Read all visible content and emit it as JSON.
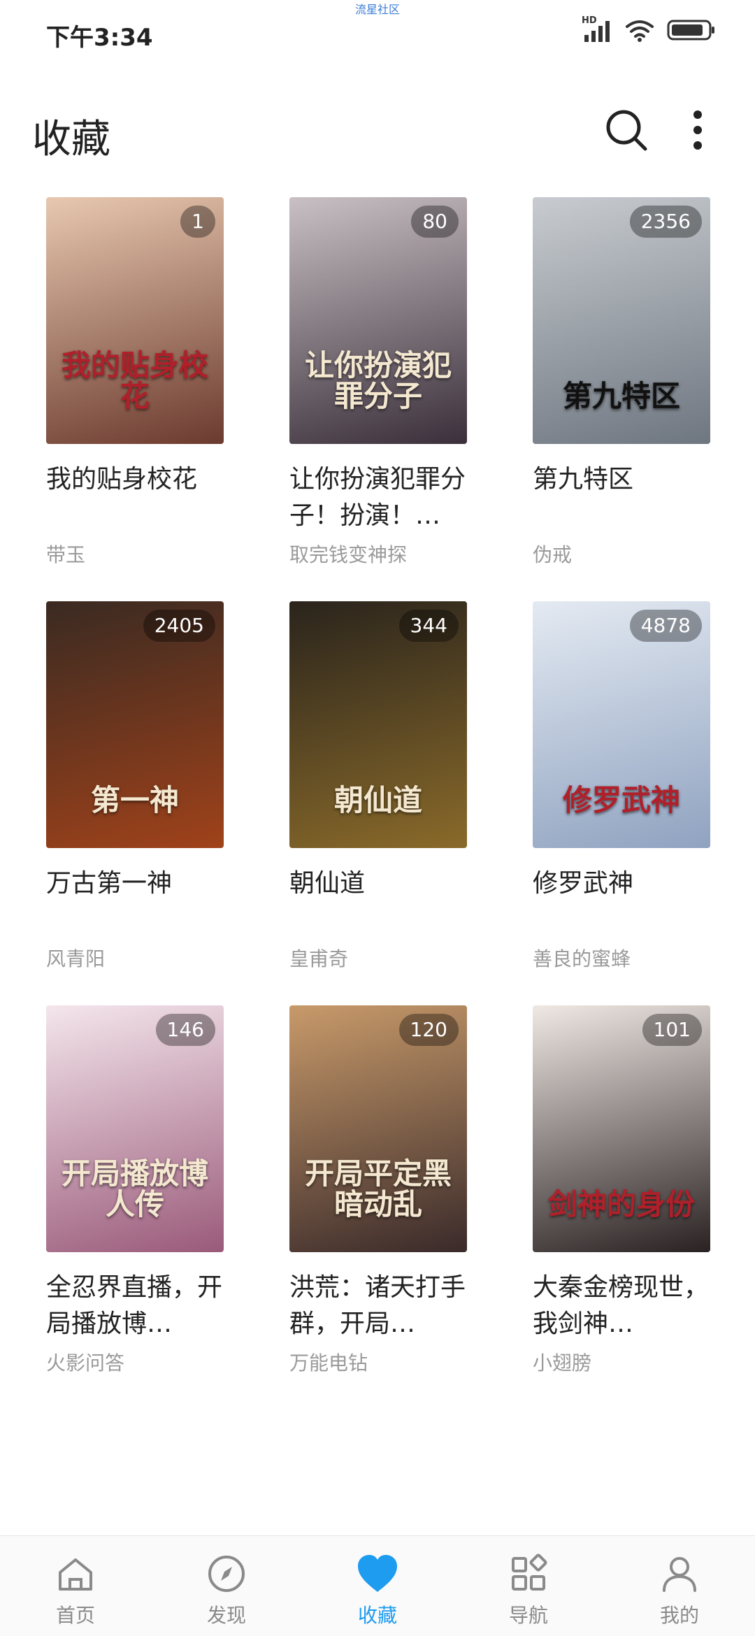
{
  "status_bar": {
    "time": "下午3:34",
    "center_text": "流星社区",
    "network_label": "HD"
  },
  "header": {
    "title": "收藏",
    "search_icon": "search-icon",
    "more_icon": "more-vertical-icon"
  },
  "books": [
    {
      "title": "我的贴身校花",
      "author": "带玉",
      "badge": "1",
      "cover_text": "我的贴身校花",
      "cover_colors": [
        "#e8c8b0",
        "#6b3a2e"
      ]
    },
    {
      "title": "让你扮演犯罪分子！扮演！…",
      "author": "取完钱变神探",
      "badge": "80",
      "cover_text": "让你扮演犯罪分子",
      "cover_colors": [
        "#c9c0c4",
        "#3a2f3a"
      ]
    },
    {
      "title": "第九特区",
      "author": "伪戒",
      "badge": "2356",
      "cover_text": "第九特区",
      "cover_colors": [
        "#c8ccd0",
        "#6e7680"
      ]
    },
    {
      "title": "万古第一神",
      "author": "风青阳",
      "badge": "2405",
      "cover_text": "第一神",
      "cover_colors": [
        "#3a2a22",
        "#a0421a"
      ]
    },
    {
      "title": "朝仙道",
      "author": "皇甫奇",
      "badge": "344",
      "cover_text": "朝仙道",
      "cover_colors": [
        "#2a241c",
        "#8a6a2a"
      ]
    },
    {
      "title": "修罗武神",
      "author": "善良的蜜蜂",
      "badge": "4878",
      "cover_text": "修罗武神",
      "cover_colors": [
        "#e4eaf2",
        "#8fa2c0"
      ]
    },
    {
      "title": "全忍界直播，开局播放博…",
      "author": "火影问答",
      "badge": "146",
      "cover_text": "开局播放博人传",
      "cover_colors": [
        "#f4e6ec",
        "#9a5a7a"
      ]
    },
    {
      "title": "洪荒：诸天打手群，开局…",
      "author": "万能电钻",
      "badge": "120",
      "cover_text": "开局平定黑暗动乱",
      "cover_colors": [
        "#c89a6a",
        "#3a2a2a"
      ]
    },
    {
      "title": "大秦金榜现世，我剑神…",
      "author": "小翅膀",
      "badge": "101",
      "cover_text": "剑神的身份",
      "cover_colors": [
        "#f0e8e4",
        "#2a2222"
      ]
    }
  ],
  "bottom_nav": [
    {
      "label": "首页",
      "icon": "home-icon",
      "active": false
    },
    {
      "label": "发现",
      "icon": "compass-icon",
      "active": false
    },
    {
      "label": "收藏",
      "icon": "heart-icon",
      "active": true
    },
    {
      "label": "导航",
      "icon": "grid-icon",
      "active": false
    },
    {
      "label": "我的",
      "icon": "user-icon",
      "active": false
    }
  ],
  "colors": {
    "accent": "#1e9cf0",
    "inactive": "#8a8a8a",
    "author": "#9a9a9a"
  }
}
